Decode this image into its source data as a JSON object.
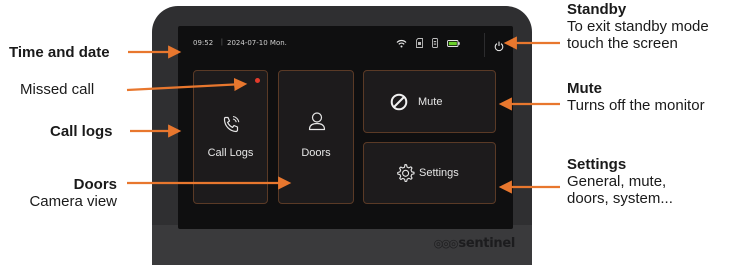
{
  "status_bar": {
    "time": "09:52",
    "date": "2024-07-10 Mon."
  },
  "tiles": {
    "call_logs": "Call Logs",
    "doors": "Doors",
    "mute": "Mute",
    "settings": "Settings"
  },
  "brand": "sentinel",
  "annotations": {
    "time_and_date": "Time and date",
    "missed_call": "Missed call",
    "call_logs": "Call logs",
    "doors_title": "Doors",
    "doors_desc": "Camera view",
    "standby_title": "Standby",
    "standby_desc_1": "To exit standby mode",
    "standby_desc_2": "touch the screen",
    "mute_title": "Mute",
    "mute_desc": "Turns off the monitor",
    "settings_title": "Settings",
    "settings_desc_1": "General, mute,",
    "settings_desc_2": "doors, system..."
  },
  "colors": {
    "accent_arrow": "#e8772e",
    "tile_border": "#5a3a26",
    "screen": "#0f0f10",
    "missed_dot": "#e33b2b",
    "battery": "#6ad12a"
  },
  "icons": [
    "wifi-icon",
    "sd-card-icon",
    "sim-icon",
    "battery-icon",
    "power-icon",
    "phone-call-icon",
    "person-icon",
    "block-icon",
    "gear-icon"
  ]
}
